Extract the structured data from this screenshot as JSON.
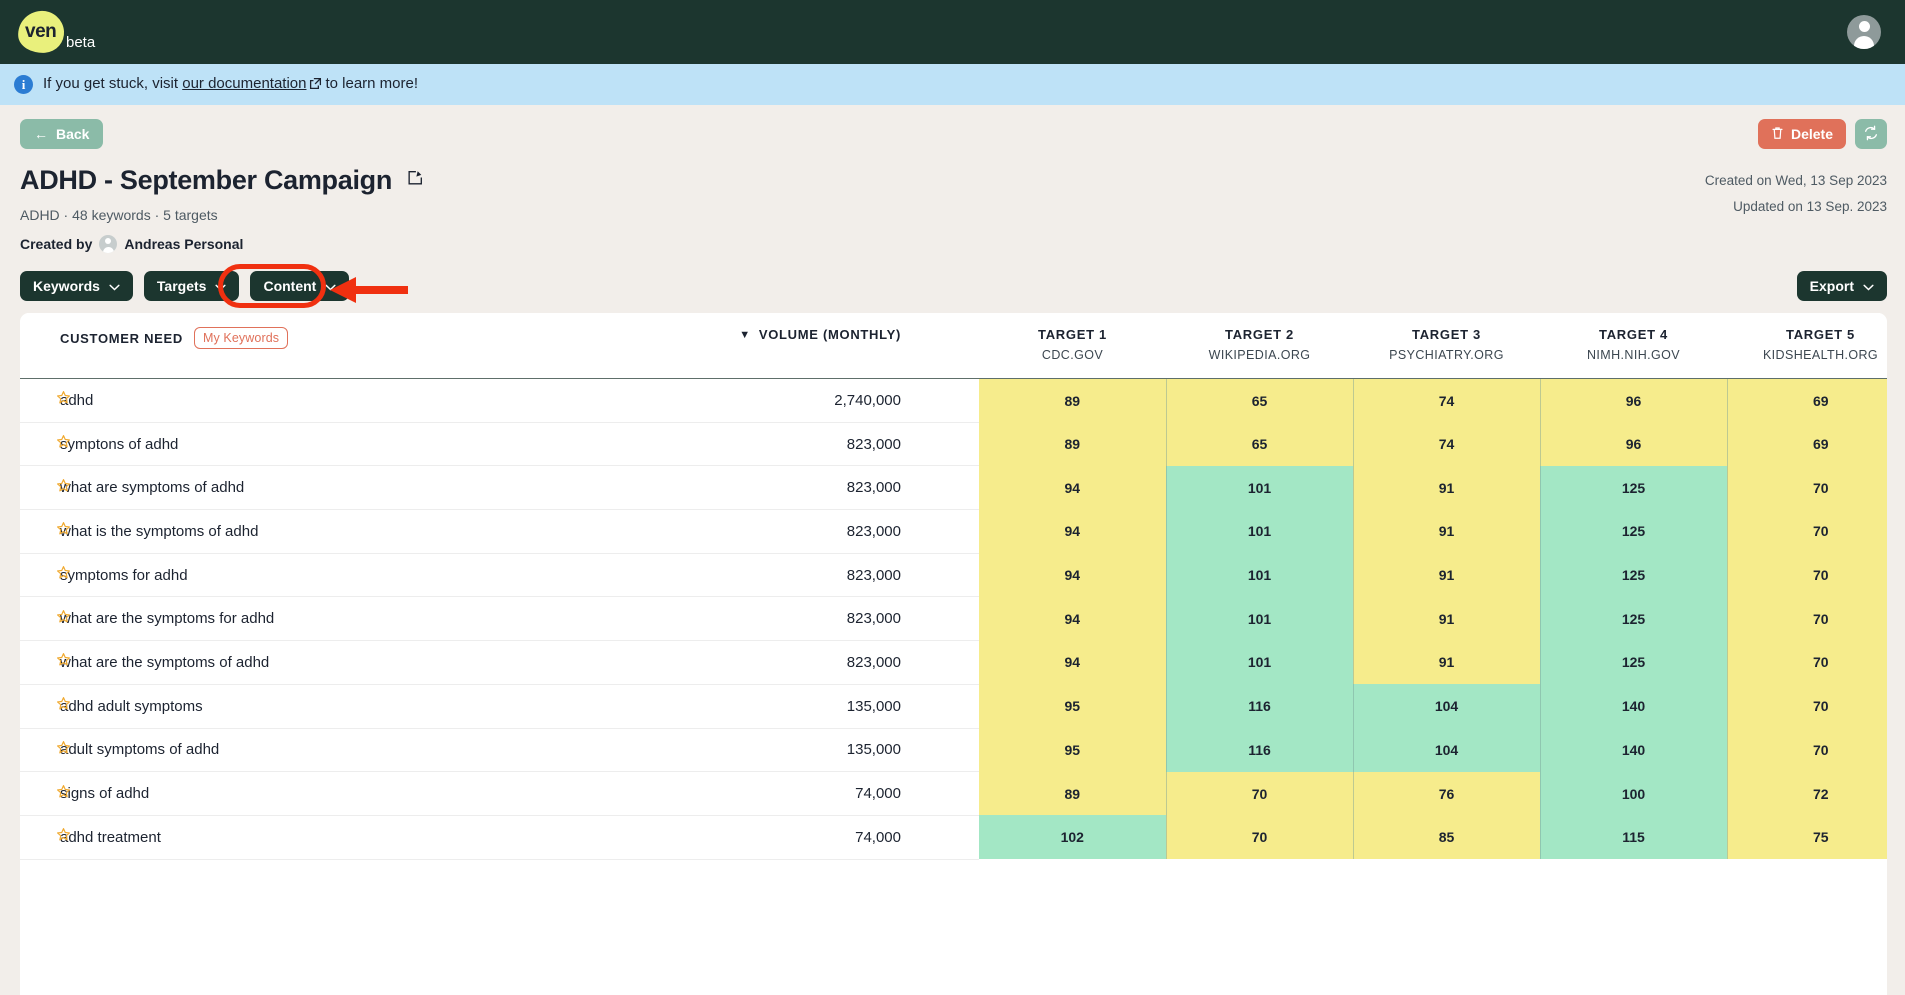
{
  "topnav": {
    "logo_text": "ven",
    "logo_suffix": "beta",
    "avatar_icon": "user-avatar-icon"
  },
  "banner": {
    "prefix": "If you get stuck, visit",
    "link_text": "our documentation",
    "suffix": "to learn more!",
    "info_icon": "info-icon",
    "external_icon": "external-link-icon",
    "background": "#BEE2F7"
  },
  "actionbar": {
    "back_label": "Back",
    "delete_label": "Delete",
    "refresh_icon": "refresh-icon",
    "back_color": "#8BBBA8",
    "delete_color": "#E0715A"
  },
  "page": {
    "title": "ADHD - September Campaign",
    "edit_icon": "edit-pencil-icon",
    "subline": "ADHD · 48 keywords · 5 targets",
    "created_by_label": "Created by",
    "created_by_name": "Andreas Personal",
    "created_on": "Created on Wed, 13 Sep 2023",
    "updated_on": "Updated on 13 Sep. 2023"
  },
  "filters": {
    "keywords_label": "Keywords",
    "targets_label": "Targets",
    "content_label": "Content",
    "export_label": "Export",
    "chevron_icon": "chevron-down-icon",
    "highlight_color": "#F03010",
    "annotation": "red-ellipse-and-arrow-pointing-to-content-button"
  },
  "chart_data": {
    "type": "table",
    "title": "Keyword coverage by target",
    "columns": [
      {
        "label": "CUSTOMER NEED",
        "badge": "My Keywords",
        "sorted": false
      },
      {
        "label": "VOLUME (MONTHLY)",
        "sorted": true,
        "sort_dir": "desc"
      },
      {
        "label": "TARGET 1",
        "sub": "CDC.GOV"
      },
      {
        "label": "TARGET 2",
        "sub": "WIKIPEDIA.ORG"
      },
      {
        "label": "TARGET 3",
        "sub": "PSYCHIATRY.ORG"
      },
      {
        "label": "TARGET 4",
        "sub": "NIMH.NIH.GOV"
      },
      {
        "label": "TARGET 5",
        "sub": "KIDSHEALTH.ORG"
      }
    ],
    "rows": [
      {
        "need": "adhd",
        "volume": "2,740,000",
        "scores": [
          89,
          65,
          74,
          96,
          69
        ],
        "colors": [
          "yellow",
          "yellow",
          "yellow",
          "yellow",
          "yellow"
        ]
      },
      {
        "need": "symptons of adhd",
        "volume": "823,000",
        "scores": [
          89,
          65,
          74,
          96,
          69
        ],
        "colors": [
          "yellow",
          "yellow",
          "yellow",
          "yellow",
          "yellow"
        ]
      },
      {
        "need": "what are symptoms of adhd",
        "volume": "823,000",
        "scores": [
          94,
          101,
          91,
          125,
          70
        ],
        "colors": [
          "yellow",
          "green",
          "yellow",
          "green",
          "yellow"
        ]
      },
      {
        "need": "what is the symptoms of adhd",
        "volume": "823,000",
        "scores": [
          94,
          101,
          91,
          125,
          70
        ],
        "colors": [
          "yellow",
          "green",
          "yellow",
          "green",
          "yellow"
        ]
      },
      {
        "need": "symptoms for adhd",
        "volume": "823,000",
        "scores": [
          94,
          101,
          91,
          125,
          70
        ],
        "colors": [
          "yellow",
          "green",
          "yellow",
          "green",
          "yellow"
        ]
      },
      {
        "need": "what are the symptoms for adhd",
        "volume": "823,000",
        "scores": [
          94,
          101,
          91,
          125,
          70
        ],
        "colors": [
          "yellow",
          "green",
          "yellow",
          "green",
          "yellow"
        ]
      },
      {
        "need": "what are the symptoms of adhd",
        "volume": "823,000",
        "scores": [
          94,
          101,
          91,
          125,
          70
        ],
        "colors": [
          "yellow",
          "green",
          "yellow",
          "green",
          "yellow"
        ]
      },
      {
        "need": "adhd adult symptoms",
        "volume": "135,000",
        "scores": [
          95,
          116,
          104,
          140,
          70
        ],
        "colors": [
          "yellow",
          "green",
          "green",
          "green",
          "yellow"
        ]
      },
      {
        "need": "adult symptoms of adhd",
        "volume": "135,000",
        "scores": [
          95,
          116,
          104,
          140,
          70
        ],
        "colors": [
          "yellow",
          "green",
          "green",
          "green",
          "yellow"
        ]
      },
      {
        "need": "signs of adhd",
        "volume": "74,000",
        "scores": [
          89,
          70,
          76,
          100,
          72
        ],
        "colors": [
          "yellow",
          "yellow",
          "yellow",
          "green",
          "yellow"
        ]
      },
      {
        "need": "adhd treatment",
        "volume": "74,000",
        "scores": [
          102,
          70,
          85,
          115,
          75
        ],
        "colors": [
          "green",
          "yellow",
          "yellow",
          "green",
          "yellow"
        ]
      }
    ],
    "cell_colors": {
      "yellow": "#F6EC8C",
      "green": "#A3E7C5"
    },
    "star_icon": "star-outline-icon"
  }
}
